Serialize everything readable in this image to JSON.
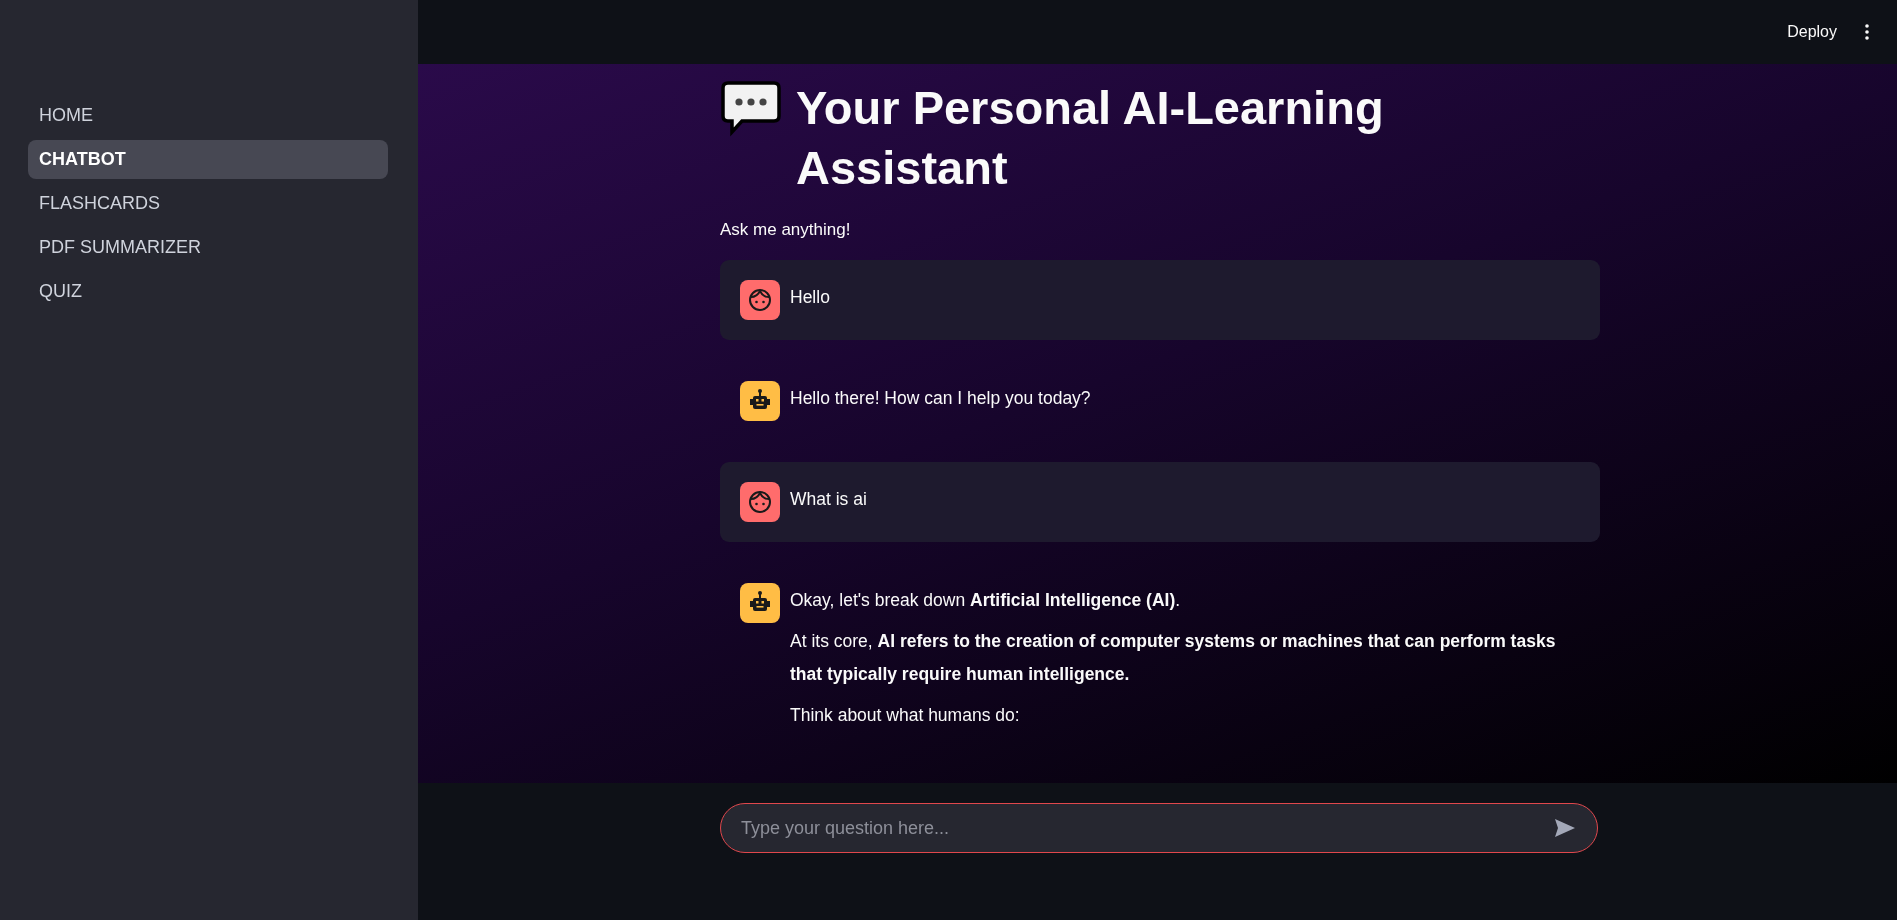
{
  "sidebar": {
    "items": [
      {
        "label": "HOME",
        "selected": false
      },
      {
        "label": "CHATBOT",
        "selected": true
      },
      {
        "label": "FLASHCARDS",
        "selected": false
      },
      {
        "label": "PDF SUMMARIZER",
        "selected": false
      },
      {
        "label": "QUIZ",
        "selected": false
      }
    ]
  },
  "header": {
    "deploy": "Deploy"
  },
  "main": {
    "title": "Your Personal AI-Learning Assistant",
    "subtitle": "Ask me anything!",
    "messages": [
      {
        "kind": "user",
        "paragraphs": [
          "Hello"
        ]
      },
      {
        "kind": "assistant",
        "paragraphs": [
          "Hello there! How can I help you today?"
        ]
      },
      {
        "kind": "user",
        "paragraphs": [
          "What is ai"
        ]
      },
      {
        "kind": "assistant",
        "paragraphs": [
          "Okay, let's break down **Artificial Intelligence (AI)**.",
          "At its core, **AI refers to the creation of computer systems or machines that can perform tasks that typically require human intelligence.**",
          "Think about what humans do:"
        ]
      }
    ]
  },
  "chat_input": {
    "placeholder": "Type your question here..."
  }
}
